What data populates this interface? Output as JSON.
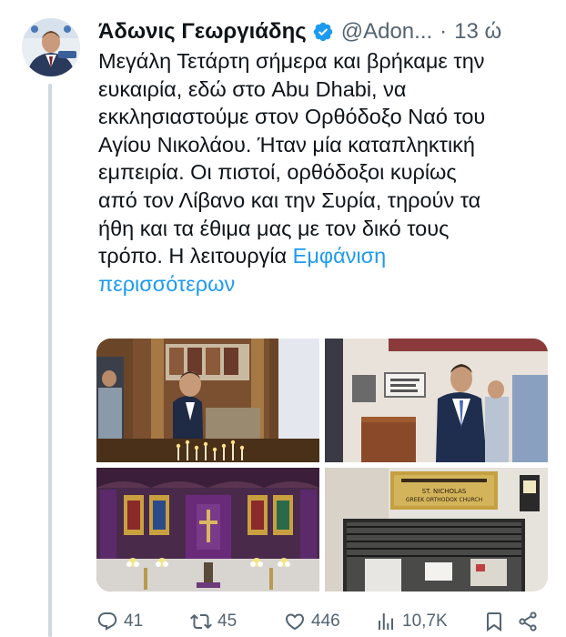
{
  "tweet": {
    "author": {
      "display_name": "Άδωνις Γεωργιάδης",
      "handle": "@Adon...",
      "verified": true,
      "avatar_icon": "avatar-photo"
    },
    "separator": "·",
    "time": "13 ώ",
    "text": "Μεγάλη Τετάρτη σήμερα και βρήκαμε την\nευκαιρία, εδώ στο Abu Dhabi, να\nεκκλησιαστούμε στον Ορθόδοξο Ναό του\nΑγίου Νικολάου. Ήταν μία καταπληκτική\nεμπειρία. Οι πιστοί, ορθόδοξοι κυρίως\nαπό τον Λίβανο και την Συρία, τηρούν τα\nήθη και τα έθιμα μας με τον δικό τους\nτρόπο. Η λειτουργία ",
    "show_more": "Εμφάνιση\nπερισσότερων",
    "media": [
      {
        "icon": "photo-candles"
      },
      {
        "icon": "photo-interior"
      },
      {
        "icon": "photo-iconostasis"
      },
      {
        "icon": "photo-church-sign"
      }
    ],
    "media_sign_text": {
      "line1": "ST. NICHOLAS",
      "line2": "GREEK ORTHODOX CHURCH"
    },
    "actions": {
      "replies": "41",
      "retweets": "45",
      "likes": "446",
      "views": "10,7K"
    },
    "colors": {
      "link": "#1d9bf0",
      "secondary_text": "#536471",
      "verified_badge": "#1d9bf0"
    }
  }
}
